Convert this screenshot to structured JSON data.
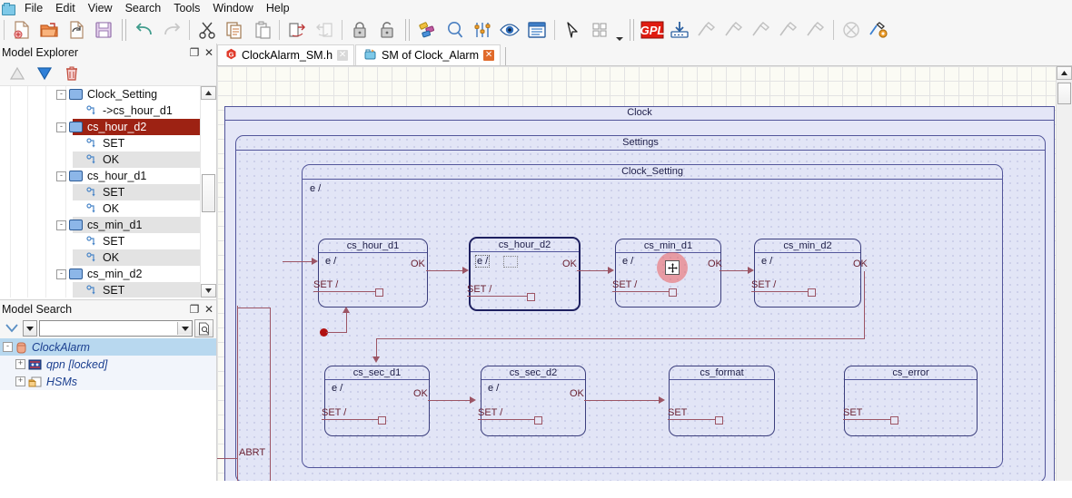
{
  "menu": {
    "app_icon": "app-icon",
    "items": [
      "File",
      "Edit",
      "View",
      "Search",
      "Tools",
      "Window",
      "Help"
    ]
  },
  "toolbar": {
    "groups": [
      {
        "buttons": [
          {
            "name": "new-file-icon",
            "enabled": true
          },
          {
            "name": "open-folder-icon",
            "enabled": true
          },
          {
            "name": "reload-file-icon",
            "enabled": true
          },
          {
            "name": "save-icon",
            "enabled": true
          }
        ]
      },
      {
        "buttons": [
          {
            "name": "undo-icon",
            "enabled": true
          },
          {
            "name": "redo-icon",
            "enabled": false
          }
        ]
      },
      {
        "buttons": [
          {
            "name": "cut-icon",
            "enabled": true
          },
          {
            "name": "copy-icon",
            "enabled": true
          },
          {
            "name": "paste-icon",
            "enabled": true
          }
        ]
      },
      {
        "buttons": [
          {
            "name": "export-icon",
            "enabled": true
          },
          {
            "name": "import-icon",
            "enabled": false
          }
        ]
      },
      {
        "buttons": [
          {
            "name": "lock-icon",
            "enabled": true
          },
          {
            "name": "unlock-icon",
            "enabled": true
          }
        ]
      },
      {
        "buttons": [
          {
            "name": "colors-icon",
            "enabled": true
          },
          {
            "name": "zoom-icon",
            "enabled": true
          },
          {
            "name": "settings-sliders-icon",
            "enabled": true
          },
          {
            "name": "eye-icon",
            "enabled": true
          },
          {
            "name": "document-view-icon",
            "enabled": true
          },
          {
            "name": "pointer-icon",
            "enabled": true
          },
          {
            "name": "grid-dropdown-icon",
            "enabled": true
          }
        ]
      },
      {
        "buttons": [
          {
            "name": "gpl-icon",
            "enabled": true
          },
          {
            "name": "download-icon",
            "enabled": true
          },
          {
            "name": "build-hammer-1-icon",
            "enabled": false
          },
          {
            "name": "build-hammer-2-icon",
            "enabled": false
          },
          {
            "name": "build-hammer-3-icon",
            "enabled": false
          },
          {
            "name": "build-hammer-4-icon",
            "enabled": false
          },
          {
            "name": "build-hammer-5-icon",
            "enabled": false
          },
          {
            "name": "stop-icon",
            "enabled": false
          },
          {
            "name": "build-settings-icon",
            "enabled": true
          }
        ]
      }
    ]
  },
  "explorer": {
    "title": "Model Explorer",
    "restore_label": "❐",
    "close_label": "✕",
    "tools": [
      {
        "name": "move-up-icon",
        "enabled": false
      },
      {
        "name": "move-down-icon",
        "enabled": true
      },
      {
        "name": "delete-icon",
        "enabled": true
      }
    ],
    "tree": [
      {
        "label": "Clock_Setting",
        "icon": "state-icon",
        "depth": 3,
        "expander": "-",
        "selected": false,
        "alt": false
      },
      {
        "label": "->cs_hour_d1",
        "icon": "transition-icon",
        "depth": 4,
        "expander": "",
        "selected": false,
        "alt": false
      },
      {
        "label": "cs_hour_d2",
        "icon": "state-icon",
        "depth": 3,
        "expander": "-",
        "selected": true,
        "alt": false
      },
      {
        "label": "SET",
        "icon": "transition-icon",
        "depth": 4,
        "expander": "",
        "selected": false,
        "alt": false
      },
      {
        "label": "OK",
        "icon": "transition-icon",
        "depth": 4,
        "expander": "",
        "selected": false,
        "alt": true
      },
      {
        "label": "cs_hour_d1",
        "icon": "state-icon",
        "depth": 3,
        "expander": "-",
        "selected": false,
        "alt": false
      },
      {
        "label": "SET",
        "icon": "transition-icon",
        "depth": 4,
        "expander": "",
        "selected": false,
        "alt": true
      },
      {
        "label": "OK",
        "icon": "transition-icon",
        "depth": 4,
        "expander": "",
        "selected": false,
        "alt": false
      },
      {
        "label": "cs_min_d1",
        "icon": "state-icon",
        "depth": 3,
        "expander": "-",
        "selected": false,
        "alt": true
      },
      {
        "label": "SET",
        "icon": "transition-icon",
        "depth": 4,
        "expander": "",
        "selected": false,
        "alt": false
      },
      {
        "label": "OK",
        "icon": "transition-icon",
        "depth": 4,
        "expander": "",
        "selected": false,
        "alt": true
      },
      {
        "label": "cs_min_d2",
        "icon": "state-icon",
        "depth": 3,
        "expander": "-",
        "selected": false,
        "alt": false
      },
      {
        "label": "SET",
        "icon": "transition-icon",
        "depth": 4,
        "expander": "",
        "selected": false,
        "alt": true
      }
    ],
    "scrollbar": {
      "up": "▲",
      "down": "▼"
    }
  },
  "model_search": {
    "title": "Model Search",
    "restore_label": "❐",
    "close_label": "✕",
    "expand_icon": "chevron-down-icon",
    "dropdown_icon": "dropdown-arrow-icon",
    "input_value": "",
    "input_placeholder": "",
    "find_icon": "find-document-icon",
    "results": [
      {
        "label": "ClockAlarm",
        "icon": "package-icon",
        "depth": 0,
        "expander": "-",
        "selected": true
      },
      {
        "label": "qpn [locked]",
        "icon": "locked-lib-icon",
        "depth": 1,
        "expander": "+",
        "selected": false
      },
      {
        "label": "HSMs",
        "icon": "folder-icon",
        "depth": 1,
        "expander": "+",
        "selected": false
      }
    ]
  },
  "editor": {
    "tabs": [
      {
        "label": "ClockAlarm_SM.h",
        "icon": "c-header-icon",
        "active": false,
        "close_style": "grey"
      },
      {
        "label": "SM of Clock_Alarm",
        "icon": "statemachine-icon",
        "active": true,
        "close_style": "red"
      }
    ]
  },
  "diagram": {
    "outer_label": "Clock",
    "settings_label": "Settings",
    "region_label": "Clock_Setting",
    "region_entry": "e /",
    "states_row1": [
      {
        "name": "cs_hour_d1",
        "entry": "e /",
        "action": "SET /",
        "selected": false
      },
      {
        "name": "cs_hour_d2",
        "entry": "e /",
        "action": "SET /",
        "selected": true
      },
      {
        "name": "cs_min_d1",
        "entry": "e /",
        "action": "SET /",
        "selected": false
      },
      {
        "name": "cs_min_d2",
        "entry": "e /",
        "action": "SET /",
        "selected": false
      }
    ],
    "states_row2": [
      {
        "name": "cs_sec_d1",
        "entry": "e /",
        "action": "SET /",
        "selected": false
      },
      {
        "name": "cs_sec_d2",
        "entry": "e /",
        "action": "SET /",
        "selected": false
      },
      {
        "name": "cs_format",
        "entry": "",
        "action": "SET",
        "selected": false
      },
      {
        "name": "cs_error",
        "entry": "",
        "action": "SET",
        "selected": false
      }
    ],
    "transitions": [
      {
        "label": "OK"
      },
      {
        "label": "OK"
      },
      {
        "label": "OK"
      },
      {
        "label": "OK"
      },
      {
        "label": "OK"
      },
      {
        "label": "OK"
      },
      {
        "label": "OK"
      }
    ],
    "edge_labels": {
      "abrt": "ABRT",
      "ok": "OK"
    },
    "cursor": {
      "name": "move-cursor",
      "color": "#eb5f5f"
    }
  },
  "colors": {
    "selection_red": "#9d2213",
    "diagram_fill": "#e2e5f6",
    "diagram_border": "#52559a",
    "transition_red": "#9c5565",
    "canvas_grid": "#e3e3e3"
  }
}
